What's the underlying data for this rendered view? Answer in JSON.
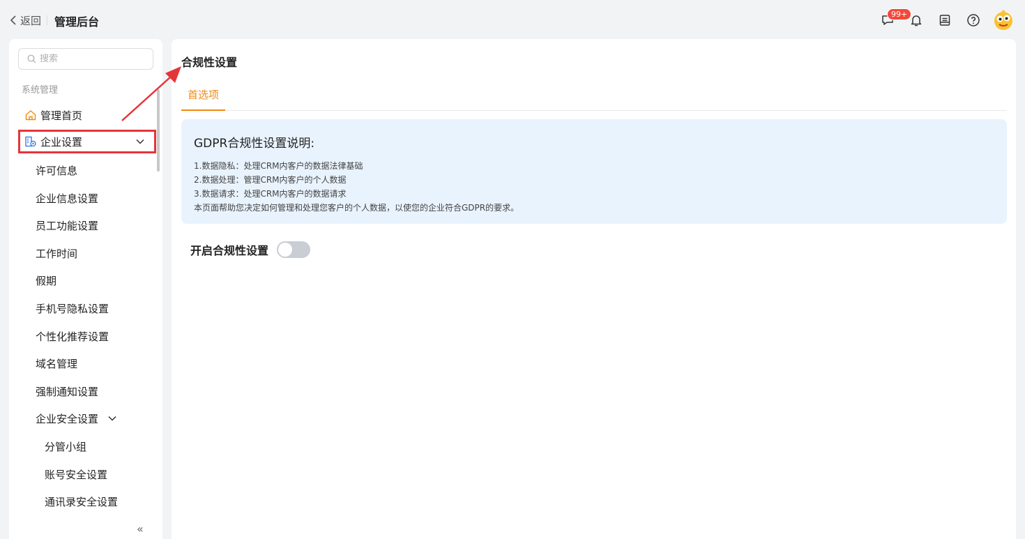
{
  "header": {
    "back_label": "返回",
    "app_title": "管理后台",
    "message_badge": "99+"
  },
  "sidebar": {
    "search_placeholder": "搜索",
    "section_label": "系统管理",
    "home_label": "管理首页",
    "enterprise_label": "企业设置",
    "sub_items": [
      "许可信息",
      "企业信息设置",
      "员工功能设置",
      "工作时间",
      "假期",
      "手机号隐私设置",
      "个性化推荐设置",
      "域名管理",
      "强制通知设置"
    ],
    "security_label": "企业安全设置",
    "security_items": [
      "分管小组",
      "账号安全设置",
      "通讯录安全设置"
    ],
    "collapse_glyph": "«"
  },
  "main": {
    "page_title": "合规性设置",
    "tab_label": "首选项",
    "info_title": "GDPR合规性设置说明:",
    "info_lines": [
      "1.数据隐私：处理CRM内客户的数据法律基础",
      "2.数据处理：管理CRM内客户的个人数据",
      "3.数据请求：处理CRM内客户的数据请求",
      "本页面帮助您决定如何管理和处理您客户的个人数据，以使您的企业符合GDPR的要求。"
    ],
    "toggle_label": "开启合规性设置",
    "toggle_on": false
  },
  "colors": {
    "accent": "#f08a10",
    "highlight_box": "#e5353a",
    "badge": "#f5473a",
    "info_bg": "#e9f3fd"
  },
  "icons": [
    "chevron-left-icon",
    "message-icon",
    "bell-icon",
    "inbox-icon",
    "help-icon",
    "avatar",
    "search-icon",
    "home-icon",
    "enterprise-icon",
    "chevron-down-icon"
  ]
}
